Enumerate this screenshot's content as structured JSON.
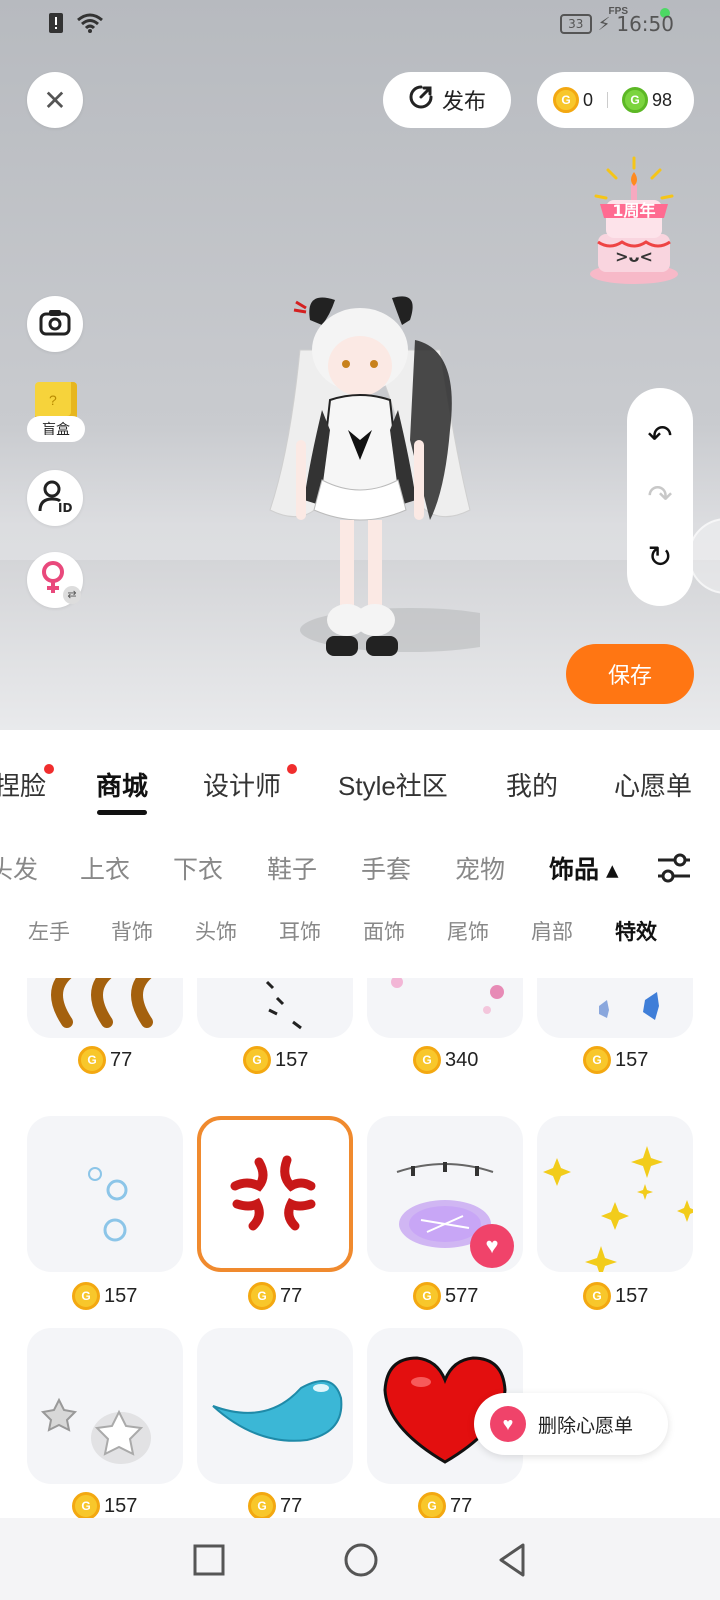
{
  "status_bar": {
    "battery": "33",
    "time": "16:50",
    "fps_label": "FPS"
  },
  "header": {
    "publish_label": "发布",
    "coin_gold": "0",
    "coin_green": "98",
    "badge_text": "1周年"
  },
  "side": {
    "blindbox_label": "盲盒"
  },
  "actions": {
    "save_label": "保存"
  },
  "tabs": [
    {
      "label": "捏脸",
      "active": false,
      "dot": true
    },
    {
      "label": "商城",
      "active": true,
      "dot": false
    },
    {
      "label": "设计师",
      "active": false,
      "dot": true
    },
    {
      "label": "Style社区",
      "active": false,
      "dot": false
    },
    {
      "label": "我的",
      "active": false,
      "dot": false
    },
    {
      "label": "心愿单",
      "active": false,
      "dot": false
    }
  ],
  "categories": [
    {
      "label": "头发"
    },
    {
      "label": "上衣"
    },
    {
      "label": "下衣"
    },
    {
      "label": "鞋子"
    },
    {
      "label": "手套"
    },
    {
      "label": "宠物"
    },
    {
      "label": "饰品 ▴",
      "active": true
    }
  ],
  "subcategories": [
    {
      "label": "左手"
    },
    {
      "label": "背饰"
    },
    {
      "label": "头饰"
    },
    {
      "label": "耳饰"
    },
    {
      "label": "面饰"
    },
    {
      "label": "尾饰"
    },
    {
      "label": "肩部"
    },
    {
      "label": "特效",
      "active": true
    }
  ],
  "items": [
    {
      "price": "77",
      "icon": "brown-claws-effect"
    },
    {
      "price": "157",
      "icon": "falling-petals-effect"
    },
    {
      "price": "340",
      "icon": "pink-sakura-effect"
    },
    {
      "price": "157",
      "icon": "blue-butterflies-effect"
    },
    {
      "price": "157",
      "icon": "bubbles-effect"
    },
    {
      "price": "77",
      "icon": "anger-mark-effect",
      "selected": true
    },
    {
      "price": "577",
      "icon": "purple-magic-circle-effect",
      "favorited": true
    },
    {
      "price": "157",
      "icon": "yellow-sparkles-effect"
    },
    {
      "price": "157",
      "icon": "grey-stars-effect"
    },
    {
      "price": "77",
      "icon": "blue-teardrop-effect"
    },
    {
      "price": "77",
      "icon": "red-heart-effect"
    }
  ],
  "wishlist_popup": {
    "label": "删除心愿单"
  },
  "colors": {
    "accent": "#ff7613",
    "selected_border": "#f08a2e",
    "favorite": "#f0436a",
    "gold_coin": "#f8c72b",
    "green_coin": "#7bd43e"
  }
}
